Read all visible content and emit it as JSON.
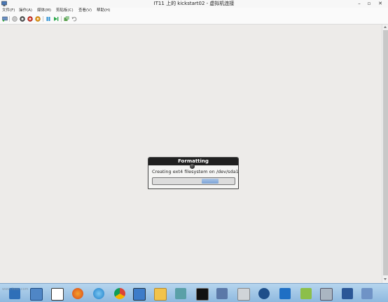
{
  "window": {
    "title": "IT11 上的 kickstart02 - 虚拟机连接"
  },
  "menu": [
    "文件(F)",
    "操作(A)",
    "媒体(M)",
    "剪贴板(C)",
    "查看(V)",
    "帮助(H)"
  ],
  "toolbar": {
    "buttons": [
      "ctrl-alt-del-icon",
      "start-icon",
      "turn-off-icon",
      "shutdown-icon",
      "save-icon",
      "pause-icon",
      "reset-icon",
      "snapshot-icon",
      "revert-icon"
    ]
  },
  "dialog": {
    "title": "Formatting",
    "message": "Creating ext4 filesystem on /dev/sda1",
    "progress_indicator": "indeterminate"
  },
  "taskbar": {
    "watermark": "www.itesc.com",
    "icons": [
      "server-manager-icon",
      "computer-icon",
      "vnc-icon",
      "firefox-icon",
      "ie-icon",
      "chrome-icon",
      "remote-desktop-icon",
      "folder-icon",
      "network-icon",
      "cmd-icon",
      "hyperv-manager-icon",
      "printer-icon",
      "xshell-icon",
      "outlook-icon",
      "notepad-icon",
      "vm-connect-icon",
      "word-icon",
      "network-settings-icon"
    ]
  }
}
